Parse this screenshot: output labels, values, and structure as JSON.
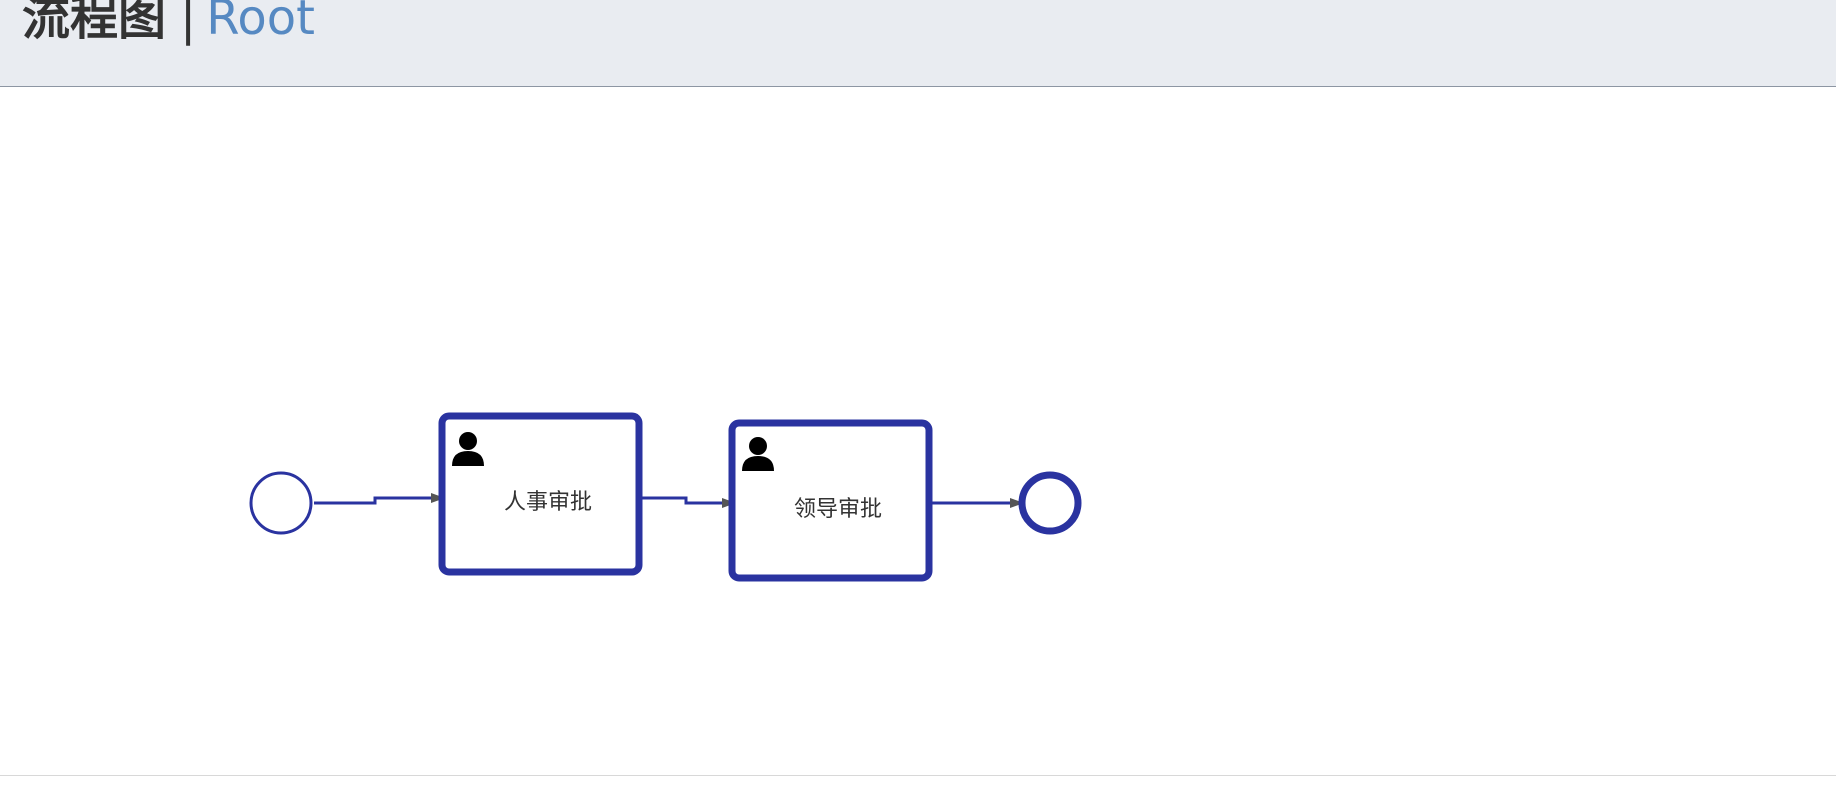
{
  "header": {
    "title": "流程图",
    "separator": "|",
    "subtitle": "Root"
  },
  "diagram": {
    "stroke_color": "#2a33a0",
    "arrow_color": "#555555",
    "icon_color": "#000000",
    "nodes": [
      {
        "id": "start",
        "type": "start-event",
        "label": ""
      },
      {
        "id": "task1",
        "type": "user-task",
        "label": "人事审批",
        "icon": "user-icon"
      },
      {
        "id": "task2",
        "type": "user-task",
        "label": "领导审批",
        "icon": "user-icon"
      },
      {
        "id": "end",
        "type": "end-event",
        "label": ""
      }
    ],
    "flows": [
      {
        "from": "start",
        "to": "task1"
      },
      {
        "from": "task1",
        "to": "task2"
      },
      {
        "from": "task2",
        "to": "end"
      }
    ]
  }
}
